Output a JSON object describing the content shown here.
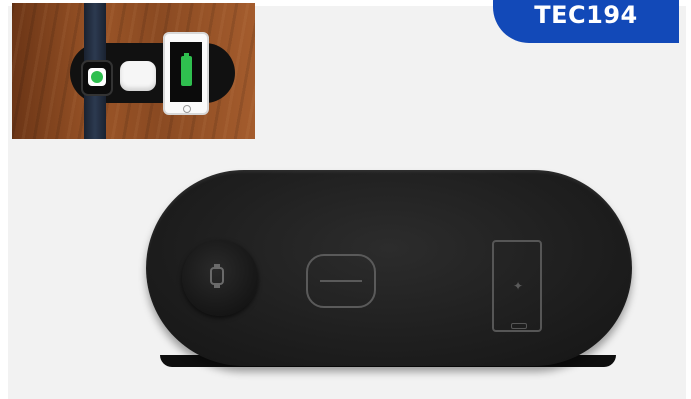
{
  "badge": {
    "label": "TEC194",
    "color": "#1249b8"
  },
  "product": {
    "inset_icons": [
      "watch-charging-icon",
      "earbuds-case-icon",
      "phone-battery-icon"
    ],
    "pad_icons": [
      "watch-icon",
      "earbuds-icon",
      "phone-charging-icon"
    ]
  }
}
